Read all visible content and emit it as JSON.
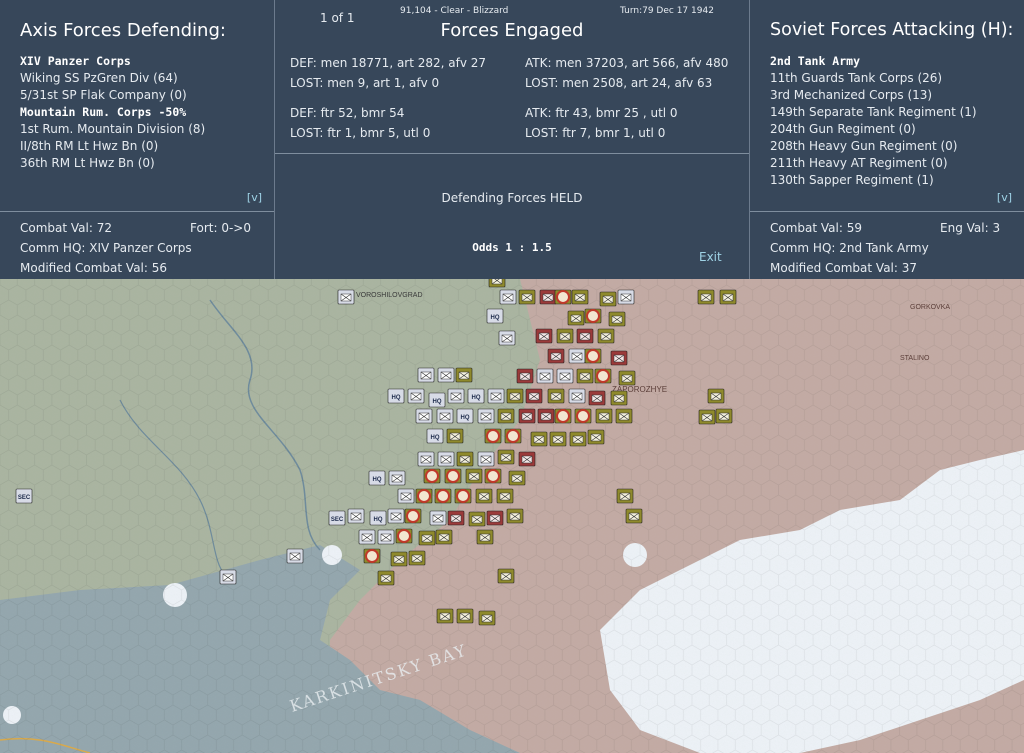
{
  "colors": {
    "panel_bg": "#37475a",
    "steppe": "#a9b4a0",
    "sea": "#93a6ad",
    "snow": "#ecf1f6",
    "axis_counter": "#d7dbe6",
    "soviet_counter": "#8f8a2c",
    "soviet_red": "#9b3a3a"
  },
  "axis": {
    "title": "Axis Forces Defending:",
    "units": [
      {
        "text": "XIV Panzer Corps",
        "bold": true
      },
      {
        "text": "Wiking SS PzGren Div (64)",
        "bold": false
      },
      {
        "text": "5/31st SP Flak Company (0)",
        "bold": false
      },
      {
        "text": "Mountain Rum. Corps  -50%",
        "bold": true
      },
      {
        "text": "1st Rum. Mountain Division (8)",
        "bold": false
      },
      {
        "text": "II/8th RM Lt Hwz Bn (0)",
        "bold": false
      },
      {
        "text": "36th RM Lt Hwz Bn (0)",
        "bold": false
      }
    ],
    "expand": "[v]",
    "combat_val": "Combat Val: 72",
    "fort": "Fort: 0->0",
    "comm_hq": "Comm HQ: XIV Panzer Corps",
    "modified": "Modified Combat Val: 56"
  },
  "engaged": {
    "pager": "1 of 1",
    "location": "91,104 - Clear - Blizzard",
    "turn": "Turn:79  Dec 17 1942",
    "title": "Forces Engaged",
    "def_ground": "DEF: men 18771, art 282, afv 27",
    "def_ground_lost": "LOST: men 9, art 1, afv 0",
    "atk_ground": "ATK: men 37203, art 566, afv 480",
    "atk_ground_lost": "LOST: men 2508, art 24, afv 63",
    "def_air": "DEF: ftr 52, bmr 54",
    "def_air_lost": "LOST: ftr 1, bmr 5, utl 0",
    "atk_air": "ATK: ftr 43, bmr 25 , utl 0",
    "atk_air_lost": "LOST: ftr 7, bmr 1, utl 0",
    "result": "Defending Forces HELD",
    "odds": "Odds 1 : 1.5",
    "exit": "Exit"
  },
  "soviet": {
    "title": "Soviet Forces Attacking (H):",
    "units": [
      {
        "text": "2nd Tank Army",
        "bold": true
      },
      {
        "text": "11th Guards Tank Corps (26)",
        "bold": false
      },
      {
        "text": "3rd Mechanized Corps (13)",
        "bold": false
      },
      {
        "text": "149th Separate Tank Regiment (1)",
        "bold": false
      },
      {
        "text": "204th Gun Regiment (0)",
        "bold": false
      },
      {
        "text": "208th Heavy Gun Regiment (0)",
        "bold": false
      },
      {
        "text": "211th Heavy AT Regiment (0)",
        "bold": false
      },
      {
        "text": "130th Sapper Regiment (1)",
        "bold": false
      }
    ],
    "expand": "[v]",
    "combat_val": "Combat Val: 59",
    "eng_val": "Eng Val: 3",
    "comm_hq": "Comm HQ: 2nd Tank Army",
    "modified": "Modified Combat Val: 37"
  },
  "map": {
    "labels": [
      "VOROSHILOVGRAD",
      "ZAPOROZHYE",
      "KARKINITSKY BAY",
      "STALINO",
      "GORKOVKA"
    ],
    "counter_labels": [
      "HQ",
      "SEC"
    ]
  }
}
